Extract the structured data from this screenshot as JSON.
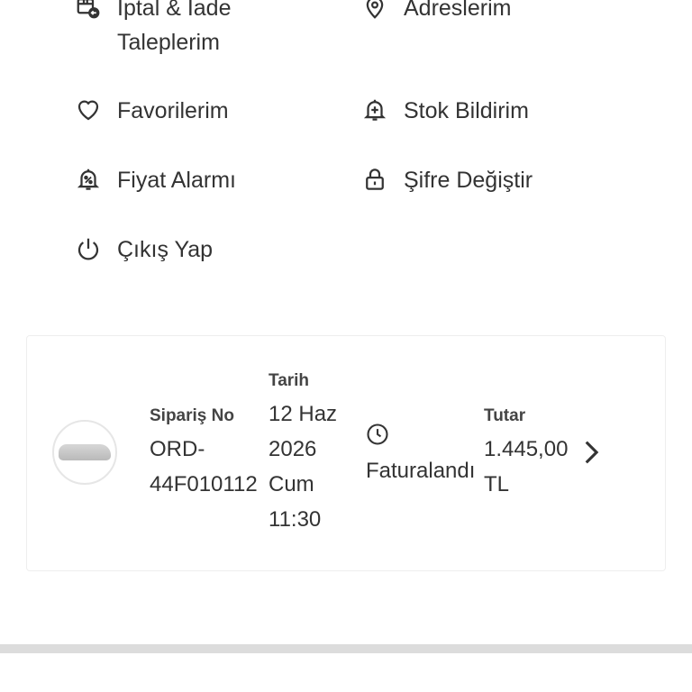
{
  "menu": {
    "iptal_iade": {
      "label": "İptal & İade\nTaleplerim",
      "icon": "return-package-icon"
    },
    "adreslerim": {
      "label": "Adreslerim",
      "icon": "location-pin-icon"
    },
    "favorilerim": {
      "label": "Favorilerim",
      "icon": "heart-icon"
    },
    "stok_bildirim": {
      "label": "Stok Bildirim",
      "icon": "bell-plus-icon"
    },
    "fiyat_alarmi": {
      "label": "Fiyat Alarmı",
      "icon": "bell-percent-icon"
    },
    "sifre_degistir": {
      "label": "Şifre Değiştir",
      "icon": "lock-icon"
    },
    "cikis_yap": {
      "label": "Çıkış Yap",
      "icon": "power-icon"
    }
  },
  "order": {
    "no_label": "Sipariş No",
    "no_value": "ORD-\n44F010112",
    "date_label": "Tarih",
    "date_value": "12 Haz\n2026\nCum\n11:30",
    "status": "Faturalandı",
    "status_icon": "clock-icon",
    "amount_label": "Tutar",
    "amount_value": "1.445,00\nTL"
  },
  "colors": {
    "text": "#333333",
    "border": "#eeeeee",
    "divider": "#dcdcdc"
  }
}
